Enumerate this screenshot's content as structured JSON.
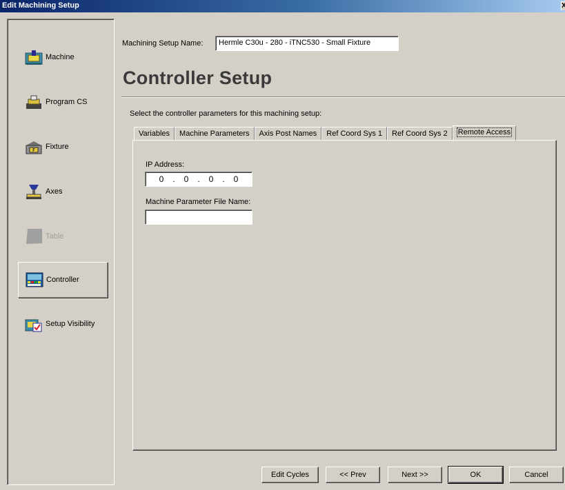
{
  "window": {
    "title": "Edit Machining Setup",
    "close_glyph": "X"
  },
  "sidebar": {
    "items": [
      {
        "label": "Machine",
        "icon": "machine-icon",
        "state": "normal"
      },
      {
        "label": "Program CS",
        "icon": "program-cs-icon",
        "state": "normal"
      },
      {
        "label": "Fixture",
        "icon": "fixture-icon",
        "state": "normal"
      },
      {
        "label": "Axes",
        "icon": "axes-icon",
        "state": "normal"
      },
      {
        "label": "Table",
        "icon": "table-icon",
        "state": "disabled"
      },
      {
        "label": "Controller",
        "icon": "controller-icon",
        "state": "selected"
      },
      {
        "label": "Setup Visibility",
        "icon": "setup-visibility-icon",
        "state": "normal"
      }
    ]
  },
  "header": {
    "setup_name_label": "Machining Setup Name:",
    "setup_name_value": "Hermle C30u - 280 - iTNC530 - Small Fixture",
    "page_title": "Controller Setup",
    "instruction": "Select the controller parameters for this machining setup:"
  },
  "tabs": [
    {
      "label": "Variables",
      "active": false
    },
    {
      "label": "Machine Parameters",
      "active": false
    },
    {
      "label": "Axis Post Names",
      "active": false
    },
    {
      "label": "Ref Coord Sys 1",
      "active": false
    },
    {
      "label": "Ref Coord Sys 2",
      "active": false
    },
    {
      "label": "Remote Access",
      "active": true
    }
  ],
  "remote_access": {
    "ip_label": "IP Address:",
    "ip_octets": [
      "0",
      "0",
      "0",
      "0"
    ],
    "ip_separator": ".",
    "param_file_label": "Machine Parameter File Name:",
    "param_file_value": ""
  },
  "footer": {
    "edit_cycles": "Edit Cycles",
    "prev": "<< Prev",
    "next": "Next >>",
    "ok": "OK",
    "cancel": "Cancel"
  },
  "colors": {
    "dialog_bg": "#d4d0c8",
    "title_start": "#0a246a",
    "title_end": "#a6caf0",
    "title_text": "#3a3a3a",
    "disabled_text": "#a0a0a0"
  }
}
